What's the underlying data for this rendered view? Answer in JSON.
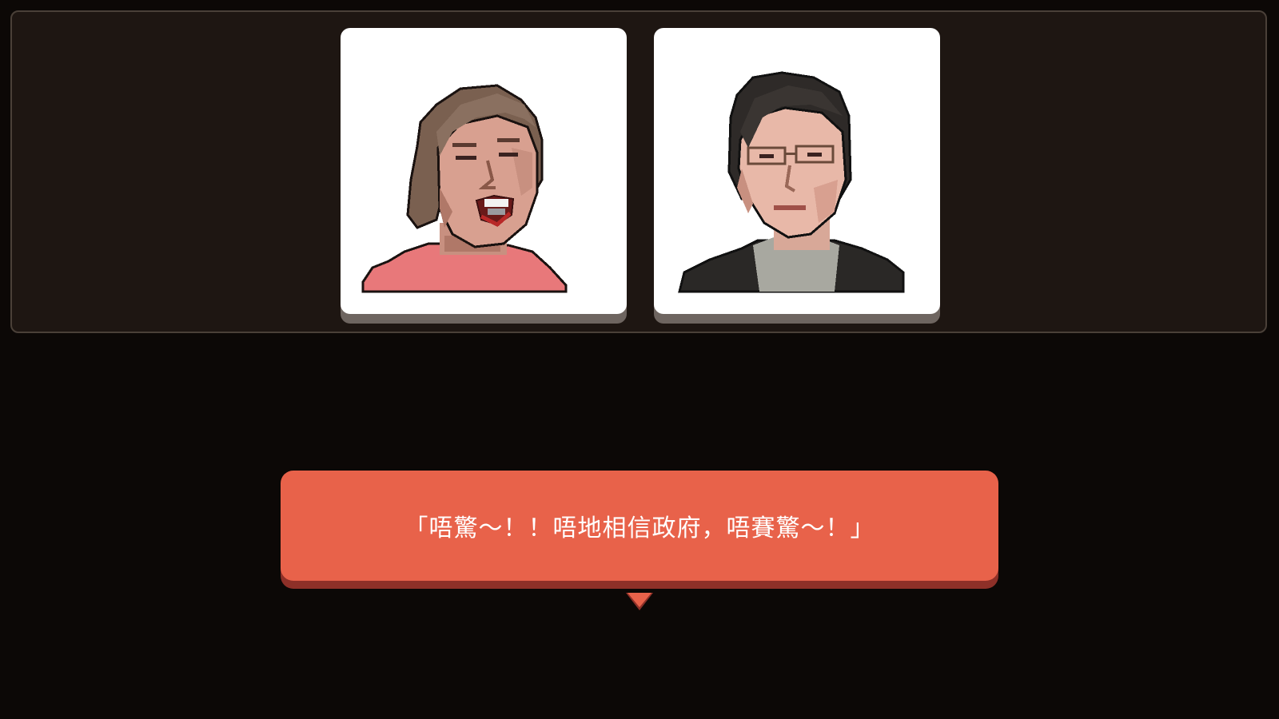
{
  "portraits": [
    {
      "name": "woman-portrait",
      "expression": "shouting",
      "hair_color": "#7a6050",
      "shirt_color": "#e8787a"
    },
    {
      "name": "man-portrait",
      "expression": "neutral",
      "hair_color": "#2e2a28",
      "shirt_color": "#2a2826"
    }
  ],
  "dialogue": {
    "text": "「唔驚～！！唔地相信政府，唔賽驚～！」"
  },
  "icons": {
    "advance": "chevron-down-icon"
  },
  "colors": {
    "background": "#0c0806",
    "panel": "#1e1612",
    "dialogue_box": "#e8624a",
    "dialogue_shadow": "#8e3028"
  }
}
